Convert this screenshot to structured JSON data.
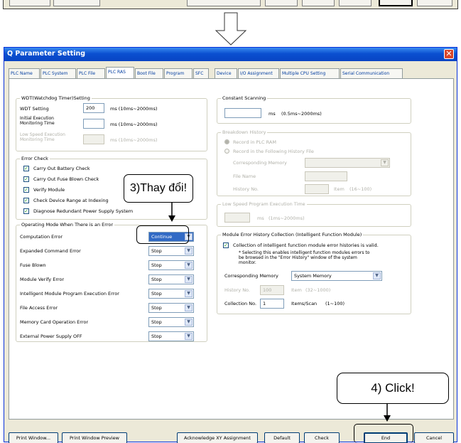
{
  "window": {
    "title": "Q Parameter Setting",
    "close_glyph": "✕"
  },
  "tabs": [
    {
      "label": "PLC Name",
      "active": false
    },
    {
      "label": "PLC System",
      "active": false
    },
    {
      "label": "PLC File",
      "active": false
    },
    {
      "label": "PLC RAS",
      "active": true
    },
    {
      "label": "Boot File",
      "active": false
    },
    {
      "label": "Program",
      "active": false
    },
    {
      "label": "SFC",
      "active": false
    },
    {
      "label": "Device",
      "active": false
    },
    {
      "label": "I/O Assignment",
      "active": false
    },
    {
      "label": "Multiple CPU Setting",
      "active": false
    },
    {
      "label": "Serial Communication",
      "active": false
    }
  ],
  "wdt": {
    "legend": "WDT(Watchdog Timer)Setting",
    "wdt_label": "WDT Setting",
    "wdt_value": "200",
    "wdt_unit": "ms (10ms~2000ms)",
    "initial_label": "Initial Execution Monitoring Time",
    "initial_value": "",
    "initial_unit": "ms (10ms~2000ms)",
    "lowspeed_label": "Low Speed Execution Monitoring Time",
    "lowspeed_value": "",
    "lowspeed_unit": "ms (10ms~2000ms)"
  },
  "error_check": {
    "legend": "Error Check",
    "items": [
      {
        "label": "Carry Out Battery Check",
        "checked": true
      },
      {
        "label": "Carry Out Fuse Blown Check",
        "checked": true
      },
      {
        "label": "Verify Module",
        "checked": true
      },
      {
        "label": "Check Device Range at Indexing",
        "checked": true
      },
      {
        "label": "Diagnose Redundant Power Supply System",
        "checked": true
      }
    ]
  },
  "operating_mode": {
    "legend": "Operating Mode When There is an Error",
    "rows": [
      {
        "label": "Computation Error",
        "value": "Continue"
      },
      {
        "label": "Expanded Command Error",
        "value": "Stop"
      },
      {
        "label": "Fuse Blown",
        "value": "Stop"
      },
      {
        "label": "Module Verify Error",
        "value": "Stop"
      },
      {
        "label": "Intelligent Module Program Execution Error",
        "value": "Stop"
      },
      {
        "label": "File Access Error",
        "value": "Stop"
      },
      {
        "label": "Memory Card Operation Error",
        "value": "Stop"
      },
      {
        "label": "External Power Supply OFF",
        "value": "Stop"
      }
    ]
  },
  "constant_scanning": {
    "legend": "Constant Scanning",
    "value": "",
    "unit": "ms",
    "range": "(0.5ms~2000ms)"
  },
  "breakdown_history": {
    "legend": "Breakdown History",
    "option1": "Record in PLC RAM",
    "option2": "Record in the Following History File",
    "memory_label": "Corresponding Memory",
    "memory_value": "",
    "file_label": "File Name",
    "file_value": "",
    "history_label": "History No.",
    "history_value": "",
    "history_unit": "Item",
    "history_range": "(16~100)"
  },
  "low_speed": {
    "legend": "Low Speed Program Execution Time",
    "value": "",
    "unit": "ms",
    "range": "(1ms~2000ms)"
  },
  "module_error": {
    "legend": "Module Error History Collection (Intelligent Function Module)",
    "checkbox_label": "Collection of intelligent function module error histories is valid.",
    "checked": true,
    "note": "* Selecting this enables intelligent function modules errors to be browsed in the \"Error History\" window of the system monitor.",
    "note_line1": "* Selecting this enables intelligent function modules errors to",
    "note_line2": "be browsed in the \"Error History\" window of the system",
    "note_line3": "monitor.",
    "memory_label": "Corresponding Memory",
    "memory_value": "System Memory",
    "history_label": "History No.",
    "history_value": "100",
    "history_unit": "Item",
    "history_range": "(32~1000)",
    "collection_label": "Collection No.",
    "collection_value": "1",
    "collection_unit": "Items/Scan",
    "collection_range": "(1~100)"
  },
  "buttons": {
    "print_window": "Print Window...",
    "print_preview": "Print Window Preview",
    "acknowledge": "Acknowledge XY Assignment",
    "default": "Default",
    "check": "Check",
    "end": "End",
    "cancel": "Cancel"
  },
  "annotations": {
    "change": "3)Thay đổi!",
    "click": "4) Click!"
  },
  "colors": {
    "title_bar": "#0a4fd0",
    "window_bg": "#ece9d8",
    "tab_text": "#003ca0",
    "check_green": "#21a121"
  }
}
